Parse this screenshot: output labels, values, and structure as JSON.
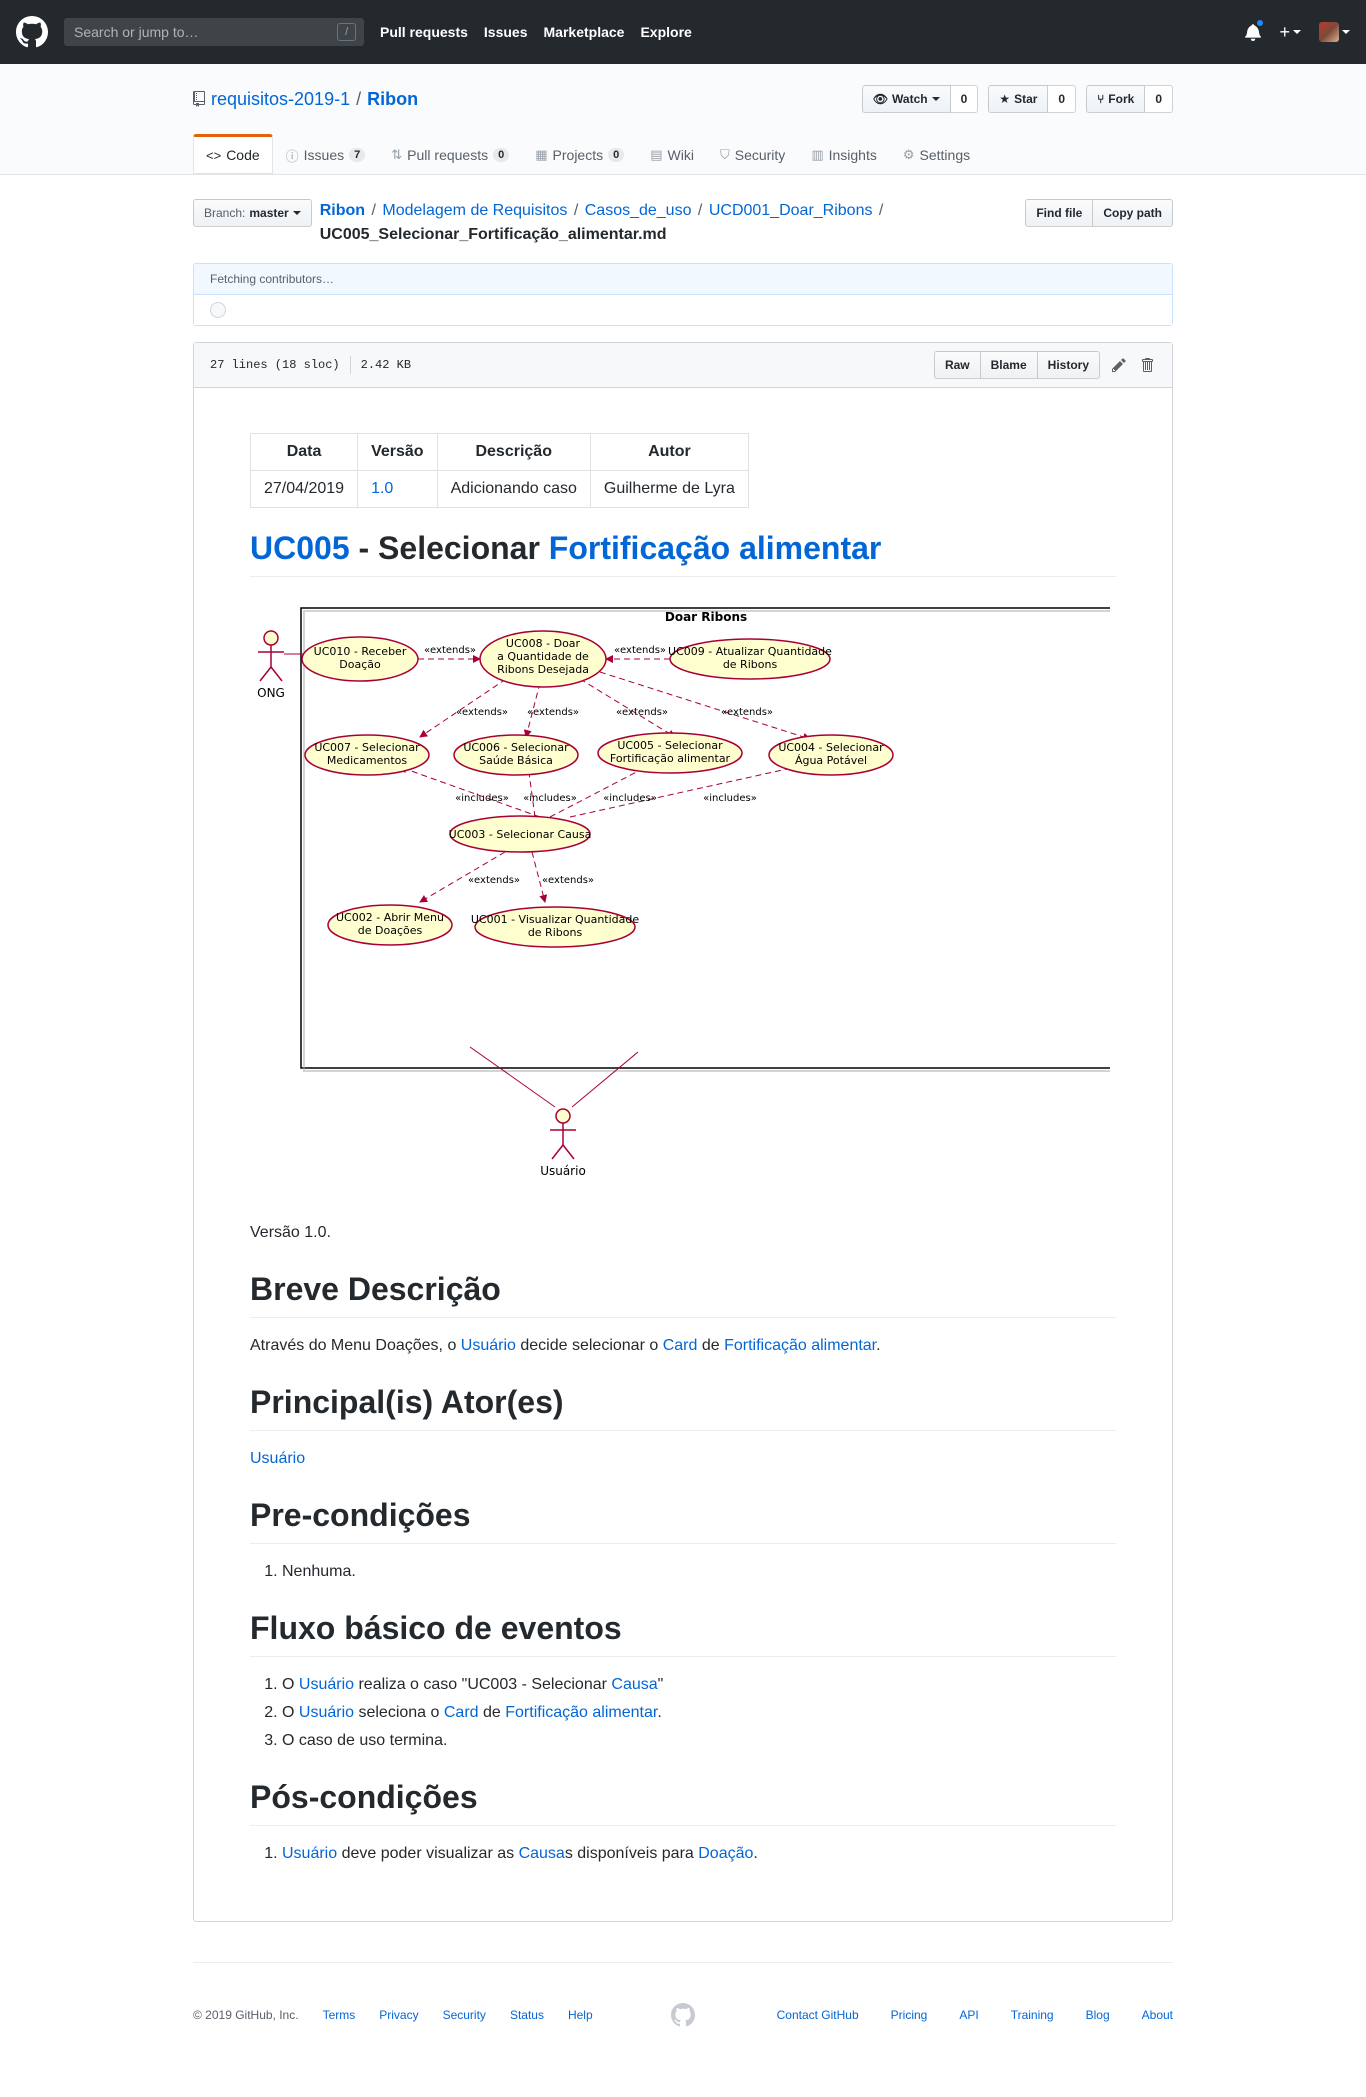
{
  "header": {
    "search_placeholder": "Search or jump to…",
    "slash_hint": "/",
    "nav": [
      "Pull requests",
      "Issues",
      "Marketplace",
      "Explore"
    ]
  },
  "repo": {
    "owner": "requisitos-2019-1",
    "separator": "/",
    "name": "Ribon",
    "watch_label": "Watch",
    "watch_count": "0",
    "star_label": "Star",
    "star_count": "0",
    "fork_label": "Fork",
    "fork_count": "0"
  },
  "tabs": [
    {
      "label": "Code",
      "icon": "code-icon"
    },
    {
      "label": "Issues",
      "count": "7",
      "icon": "issue-icon"
    },
    {
      "label": "Pull requests",
      "count": "0",
      "icon": "pull-request-icon"
    },
    {
      "label": "Projects",
      "count": "0",
      "icon": "project-icon"
    },
    {
      "label": "Wiki",
      "icon": "book-icon"
    },
    {
      "label": "Security",
      "icon": "shield-icon"
    },
    {
      "label": "Insights",
      "icon": "graph-icon"
    },
    {
      "label": "Settings",
      "icon": "gear-icon"
    }
  ],
  "filenav": {
    "branch_label": "Branch:",
    "branch_value": "master",
    "crumbs": [
      "Ribon",
      "Modelagem de Requisitos",
      "Casos_de_uso",
      "UCD001_Doar_Ribons"
    ],
    "filename": "UC005_Selecionar_Fortificação_alimentar.md",
    "find_file": "Find file",
    "copy_path": "Copy path"
  },
  "contributors": {
    "text": "Fetching contributors…"
  },
  "file": {
    "lines": "27 lines (18 sloc)",
    "size": "2.42 KB",
    "raw": "Raw",
    "blame": "Blame",
    "history": "History"
  },
  "doc": {
    "table": {
      "headers": [
        "Data",
        "Versão",
        "Descrição",
        "Autor"
      ],
      "row": {
        "data": "27/04/2019",
        "versao": "1.0",
        "descricao": "Adicionando caso",
        "autor": "Guilherme de Lyra"
      }
    },
    "title": {
      "link1": "UC005",
      "mid": " - Selecionar ",
      "link2": "Fortificação alimentar"
    },
    "diagram": {
      "package": "Doar Ribons",
      "actor_ong": "ONG",
      "actor_user": "Usuário",
      "uc010": [
        "UC010 - Receber",
        "Doação"
      ],
      "uc008": [
        "UC008 - Doar",
        "a Quantidade de",
        "Ribons Desejada"
      ],
      "uc009": [
        "UC009 - Atualizar Quantidade",
        "de Ribons"
      ],
      "uc007": [
        "UC007 - Selecionar",
        "Medicamentos"
      ],
      "uc006": [
        "UC006 - Selecionar",
        "Saúde Básica"
      ],
      "uc005": [
        "UC005 - Selecionar",
        "Fortificação alimentar"
      ],
      "uc004": [
        "UC004 - Selecionar",
        "Água Potável"
      ],
      "uc003": "UC003 - Selecionar Causa",
      "uc002": [
        "UC002 - Abrir Menu",
        "de Doações"
      ],
      "uc001": [
        "UC001 - Visualizar Quantidade",
        "de Ribons"
      ],
      "extends": "«extends»",
      "includes": "«includes»"
    },
    "version_line": "Versão 1.0.",
    "s_breve": "Breve Descrição",
    "breve": {
      "p1": "Através do Menu Doações, o ",
      "l1": "Usuário",
      "p2": " decide selecionar o ",
      "l2": "Card",
      "p3": " de ",
      "l3": "Fortificação alimentar",
      "p4": "."
    },
    "s_atores": "Principal(is) Ator(es)",
    "ator": "Usuário",
    "s_pre": "Pre-condições",
    "pre_item": "Nenhuma.",
    "s_fluxo": "Fluxo básico de eventos",
    "fluxo": {
      "i1": {
        "a": "O ",
        "l1": "Usuário",
        "b": " realiza o caso \"UC003 - Selecionar ",
        "l2": "Causa",
        "c": "\""
      },
      "i2": {
        "a": "O ",
        "l1": "Usuário",
        "b": " seleciona o ",
        "l2": "Card",
        "c": " de ",
        "l3": "Fortificação alimentar",
        "d": "."
      },
      "i3": "O caso de uso termina."
    },
    "s_pos": "Pós-condições",
    "pos": {
      "l1": "Usuário",
      "a": " deve poder visualizar as ",
      "l2": "Causa",
      "b": "s disponíveis para ",
      "l3": "Doação",
      "c": "."
    }
  },
  "footer": {
    "copyright": "© 2019 GitHub, Inc.",
    "left_links": [
      "Terms",
      "Privacy",
      "Security",
      "Status",
      "Help"
    ],
    "right_links": [
      "Contact GitHub",
      "Pricing",
      "API",
      "Training",
      "Blog",
      "About"
    ]
  }
}
